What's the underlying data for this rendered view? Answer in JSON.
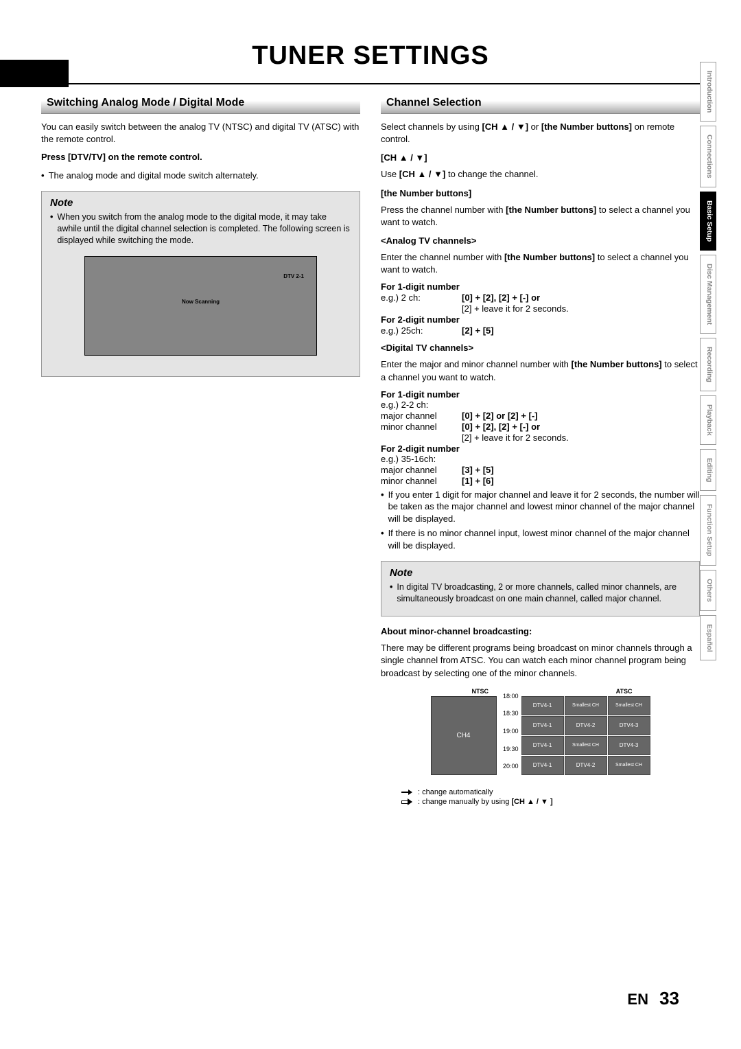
{
  "page": {
    "title": "TUNER SETTINGS",
    "lang": "EN",
    "number": "33"
  },
  "side_tabs": [
    "Introduction",
    "Connections",
    "Basic Setup",
    "Disc Management",
    "Recording",
    "Playback",
    "Editing",
    "Function Setup",
    "Others",
    "Español"
  ],
  "side_active": "Basic Setup",
  "left": {
    "heading": "Switching Analog Mode / Digital Mode",
    "intro": "You can easily switch between the analog TV (NTSC) and digital TV (ATSC) with the remote control.",
    "press_h": "Press [DTV/TV] on the remote control.",
    "press_b": "The analog mode and digital mode switch alternately.",
    "note_title": "Note",
    "note_body": "When you switch from the analog mode to the digital mode, it may take awhile until the digital channel selection is completed. The following screen is displayed while switching the mode.",
    "tv_dtv": "DTV 2-1",
    "tv_scan": "Now Scanning"
  },
  "right": {
    "heading": "Channel Selection",
    "intro_a": "Select channels by using ",
    "intro_ch": "[CH ▲ / ▼]",
    "intro_b": " or ",
    "intro_nb": "[the Number buttons]",
    "intro_c": " on remote control.",
    "sub1": "[CH ▲ / ▼]",
    "sub1_txt_a": "Use ",
    "sub1_txt_b": "[CH ▲ / ▼]",
    "sub1_txt_c": " to change the channel.",
    "sub2": "[the Number buttons]",
    "sub2_txt_a": "Press the channel number with ",
    "sub2_txt_b": "[the Number buttons]",
    "sub2_txt_c": " to select a channel you want to watch.",
    "analog_h": "<Analog TV channels>",
    "analog_intro_a": "Enter the channel number with ",
    "analog_intro_b": "[the Number buttons]",
    "analog_intro_c": " to select a channel you want to watch.",
    "d1_h": "For 1-digit number",
    "d1_row1_l": "e.g.) 2 ch:",
    "d1_row1_v": "[0] + [2], [2] + [-] or",
    "d1_row2_v": "[2] + leave it for 2 seconds.",
    "d2_h": "For 2-digit number",
    "d2_row_l": "e.g.) 25ch:",
    "d2_row_v": "[2] + [5]",
    "digital_h": "<Digital TV channels>",
    "digital_intro_a": "Enter the major and minor channel number with ",
    "digital_intro_b": "[the Number buttons]",
    "digital_intro_c": " to select a channel you want to watch.",
    "dd1_h": "For 1-digit number",
    "dd1_eg": "e.g.) 2-2 ch:",
    "dd1_r1_l": "major channel",
    "dd1_r1_v": "[0] + [2] or [2] + [-]",
    "dd1_r2_l": "minor channel",
    "dd1_r2_v": "[0] + [2], [2] + [-] or",
    "dd1_r3_v": "[2] + leave it for 2 seconds.",
    "dd2_h": "For 2-digit number",
    "dd2_eg": "e.g.) 35-16ch:",
    "dd2_r1_l": "major channel",
    "dd2_r1_v": "[3] + [5]",
    "dd2_r2_l": "minor channel",
    "dd2_r2_v": "[1] + [6]",
    "bul1": "If you enter 1 digit for major channel and leave it for 2 seconds, the number will be taken as the major channel and lowest minor channel of the major channel will be displayed.",
    "bul2": "If there is no minor channel input, lowest minor channel of the major channel will be displayed.",
    "note_title": "Note",
    "note_body": "In digital TV broadcasting, 2 or more channels, called minor channels, are simultaneously broadcast on one main channel, called major channel.",
    "about_h": "About minor-channel broadcasting:",
    "about_txt": "There may be different programs being broadcast on minor channels through a single channel from ATSC. You can watch each minor channel program being broadcast by selecting one of the minor channels.",
    "diag": {
      "ntsc": "NTSC",
      "atsc": "ATSC",
      "ch4": "CH4",
      "times": [
        "18:00",
        "18:30",
        "19:00",
        "19:30",
        "20:00"
      ],
      "cells": {
        "r1c1": "DTV4-1",
        "r1c2": "Smallest CH",
        "r1c3": "Smallest CH",
        "r2c1": "DTV4-1",
        "r2c2": "DTV4-2",
        "r2c3": "DTV4-3",
        "r3c1": "DTV4-1",
        "r3c2": "Smallest CH",
        "r3c3": "DTV4-3",
        "r4c1": "DTV4-1",
        "r4c2": "DTV4-2",
        "r4c3": "Smallest CH"
      }
    },
    "legend_auto": " : change automatically",
    "legend_man_a": " : change manually by using ",
    "legend_man_b": "[CH ▲ / ▼ ]"
  }
}
